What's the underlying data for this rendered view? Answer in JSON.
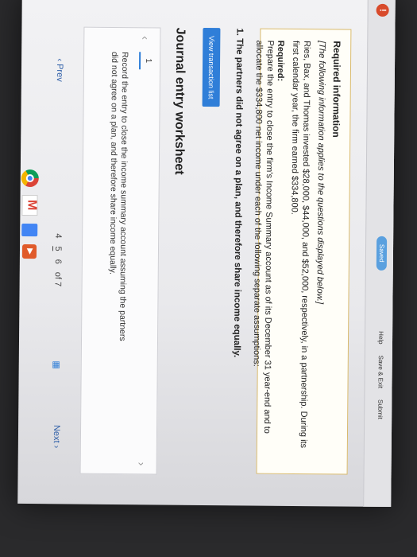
{
  "topbar": {
    "alert_count": "!",
    "saved": "Saved",
    "help": "Help",
    "save_exit": "Save & Exit",
    "submit": "Submit"
  },
  "required": {
    "title": "Required information",
    "italic": "[The following information applies to the questions displayed below.]",
    "text": "Ries, Bax, and Thomas invested $28,000, $44,000, and $52,000, respectively, in a partnership. During its first calendar year, the firm earned $334,800.",
    "required_label": "Required:",
    "required_text": "Prepare the entry to close the firm's Income Summary account as of its December 31 year-end and to allocate the $334,800 net income under each of the following separate assumptions:"
  },
  "question": "1. The partners did not agree on a plan, and therefore share income equally.",
  "view_button": "View transaction list",
  "worksheet": {
    "title": "Journal entry worksheet",
    "entry_number": "1",
    "instruction": "Record the entry to close the income summary account assuming the partners did not agree on a plan, and therefore share income equally."
  },
  "pager": {
    "prev": "Prev",
    "pages": [
      "4",
      "5",
      "6"
    ],
    "current": "5",
    "of": "of 7",
    "next": "Next"
  },
  "dock_icons": [
    "chrome-icon",
    "gmail-icon",
    "docs-icon",
    "play-icon"
  ]
}
